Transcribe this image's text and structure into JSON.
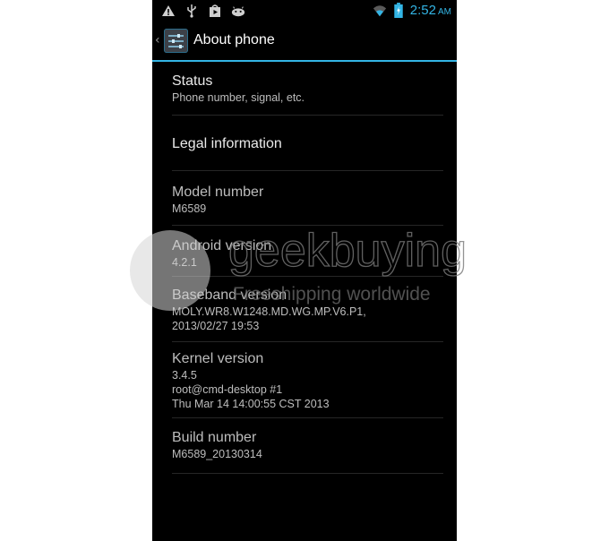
{
  "status_bar": {
    "icons_left": [
      "warning-icon",
      "usb-icon",
      "play-store-icon",
      "android-debug-icon"
    ],
    "icons_right": [
      "wifi-icon",
      "battery-charging-icon"
    ],
    "time": "2:52",
    "ampm": "AM",
    "accent_color": "#33b5e5"
  },
  "action_bar": {
    "back_glyph": "‹",
    "title": "About phone"
  },
  "items": [
    {
      "title": "Status",
      "lines": [
        "Phone number, signal, etc."
      ]
    },
    {
      "title": "Legal information",
      "lines": []
    },
    {
      "title": "Model number",
      "lines": [
        "M6589"
      ]
    },
    {
      "title": "Android version",
      "lines": [
        "4.2.1"
      ]
    },
    {
      "title": "Baseband version",
      "lines": [
        "MOLY.WR8.W1248.MD.WG.MP.V6.P1,",
        "2013/02/27 19:53"
      ]
    },
    {
      "title": "Kernel version",
      "lines": [
        "3.4.5",
        "root@cmd-desktop #1",
        "Thu Mar 14 14:00:55 CST 2013"
      ]
    },
    {
      "title": "Build number",
      "lines": [
        "M6589_20130314"
      ]
    }
  ],
  "watermark": {
    "brand": "geekbuying",
    "tagline": "Freeshipping worldwide"
  }
}
